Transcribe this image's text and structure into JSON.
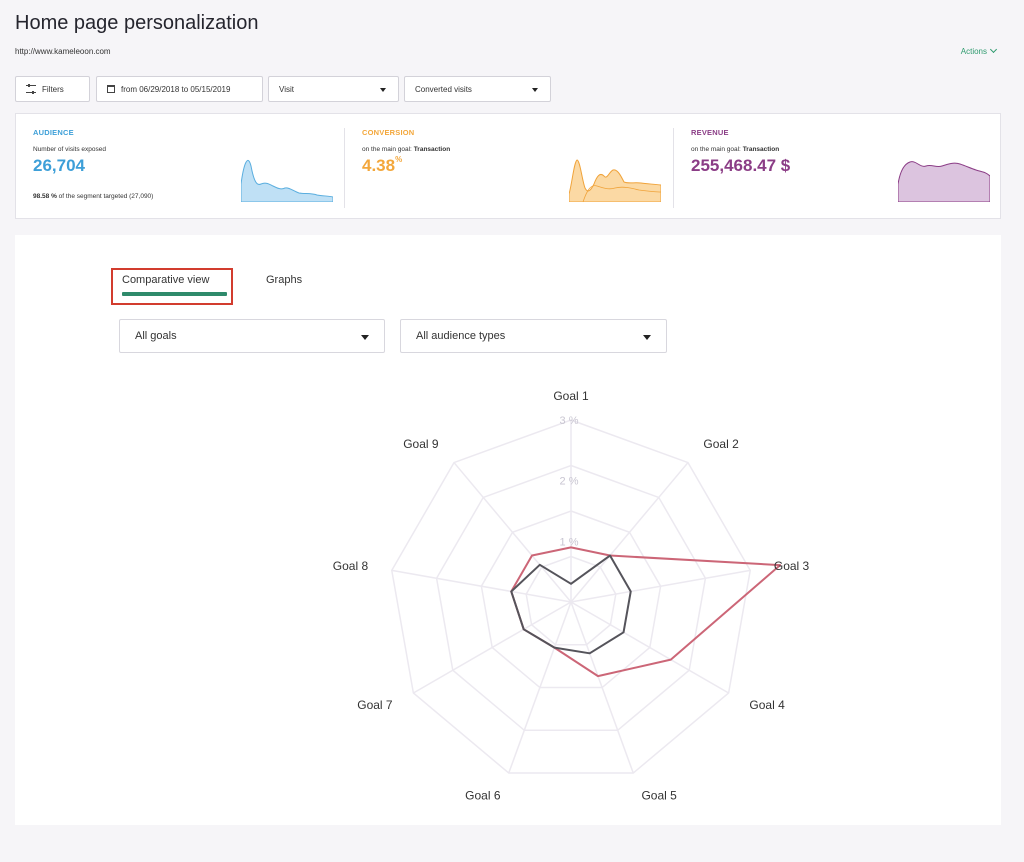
{
  "header": {
    "title": "Home page personalization",
    "url": "http://www.kameleoon.com",
    "actions_label": "Actions"
  },
  "toolbar": {
    "filters_label": "Filters",
    "date_range": "from 06/29/2018 to 05/15/2019",
    "visit_select": "Visit",
    "converted_select": "Converted visits"
  },
  "kpis": {
    "audience": {
      "label": "AUDIENCE",
      "subtitle": "Number of visits exposed",
      "value": "26,704",
      "footer_pct": "98.58 %",
      "footer_text": " of the segment targeted (27,090)",
      "color": "#3d9fd8"
    },
    "conversion": {
      "label": "CONVERSION",
      "subtitle_prefix": "on the main goal: ",
      "subtitle_goal": "Transaction",
      "value": "4.38",
      "unit": "%",
      "color": "#f3a73b"
    },
    "revenue": {
      "label": "REVENUE",
      "subtitle_prefix": "on the main goal: ",
      "subtitle_goal": "Transaction",
      "value": "255,468.47 $",
      "color": "#8b3d86"
    }
  },
  "tabs": {
    "comparative": "Comparative view",
    "graphs": "Graphs",
    "active": "comparative"
  },
  "filters": {
    "goals_select": "All goals",
    "audience_select": "All audience types"
  },
  "chart_data": {
    "type": "radar",
    "axes": [
      "Goal 1",
      "Goal 2",
      "Goal 3",
      "Goal 4",
      "Goal 5",
      "Goal 6",
      "Goal 7",
      "Goal 8",
      "Goal 9"
    ],
    "ticks": [
      "1 %",
      "2 %",
      "3 %"
    ],
    "rmax": 3,
    "series": [
      {
        "values": [
          0.9,
          1.0,
          3.5,
          1.9,
          1.3,
          0.8,
          0.9,
          1.0,
          1.0
        ],
        "color": "#cc6677"
      },
      {
        "values": [
          0.3,
          1.0,
          1.0,
          1.0,
          0.9,
          0.8,
          0.9,
          1.0,
          0.8
        ],
        "color": "#55545b"
      }
    ],
    "grid_color": "#ece9f0"
  }
}
